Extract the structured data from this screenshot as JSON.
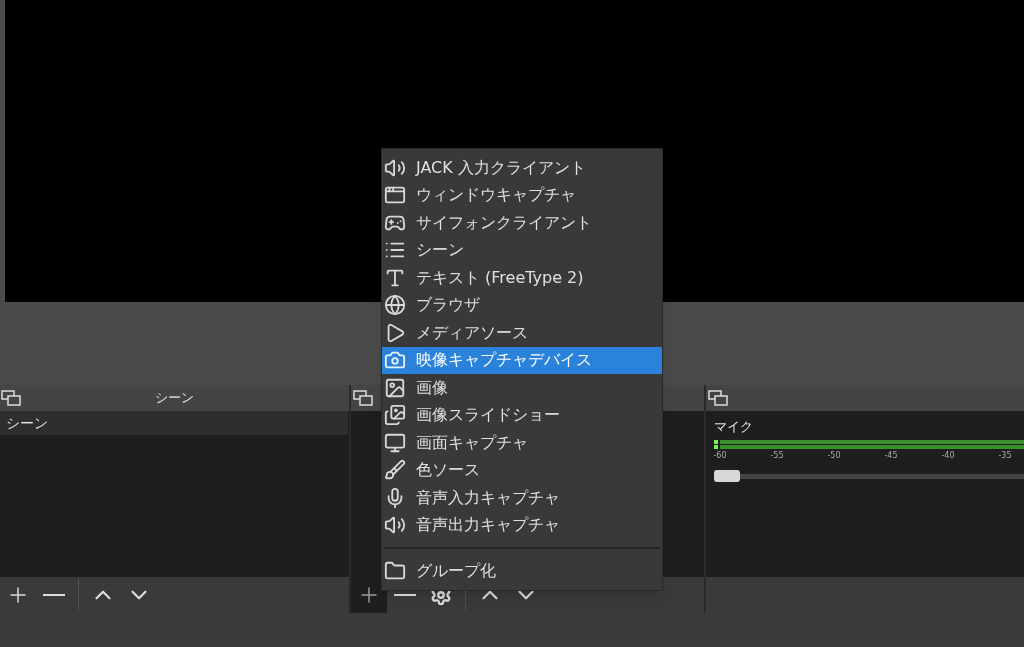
{
  "scenes_dock": {
    "title": "シーン",
    "items": [
      {
        "label": "シーン",
        "selected": true
      }
    ]
  },
  "sources_dock": {
    "add_pressed": true
  },
  "mixer_dock": {
    "channels": [
      {
        "name": "マイク",
        "meter_ticks": [
          "-60",
          "-55",
          "-50",
          "-45",
          "-40",
          "-35"
        ],
        "level": 0
      }
    ]
  },
  "add_source_menu": {
    "items": [
      {
        "kind": "speaker",
        "label": "JACK 入力クライアント",
        "selected": false
      },
      {
        "kind": "window",
        "label": "ウィンドウキャプチャ",
        "selected": false
      },
      {
        "kind": "gamepad",
        "label": "サイフォンクライアント",
        "selected": false
      },
      {
        "kind": "list",
        "label": "シーン",
        "selected": false
      },
      {
        "kind": "text",
        "label": "テキスト (FreeType 2)",
        "selected": false
      },
      {
        "kind": "globe",
        "label": "ブラウザ",
        "selected": false
      },
      {
        "kind": "play",
        "label": "メディアソース",
        "selected": false
      },
      {
        "kind": "camera",
        "label": "映像キャプチャデバイス",
        "selected": true
      },
      {
        "kind": "image",
        "label": "画像",
        "selected": false
      },
      {
        "kind": "slideshow",
        "label": "画像スライドショー",
        "selected": false
      },
      {
        "kind": "monitor",
        "label": "画面キャプチャ",
        "selected": false
      },
      {
        "kind": "brush",
        "label": "色ソース",
        "selected": false
      },
      {
        "kind": "mic",
        "label": "音声入力キャプチャ",
        "selected": false
      },
      {
        "kind": "speaker",
        "label": "音声出力キャプチャ",
        "selected": false
      },
      {
        "kind": "separator"
      },
      {
        "kind": "folder",
        "label": "グループ化",
        "selected": false
      }
    ]
  }
}
